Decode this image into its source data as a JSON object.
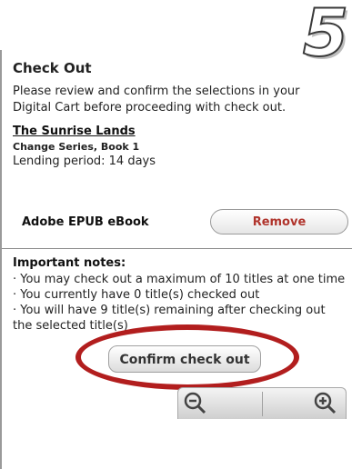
{
  "step_number": "5",
  "checkout": {
    "title": "Check Out",
    "intro": "Please review and confirm the selections in your Digital Cart before proceeding with check out."
  },
  "item": {
    "title": "The Sunrise Lands",
    "series": "Change Series, Book 1",
    "lending_period": "Lending period: 14 days",
    "format": "Adobe EPUB eBook",
    "remove_label": "Remove"
  },
  "notes": {
    "heading": "Important notes:",
    "lines": [
      "· You may check out a maximum of 10 titles at one time",
      "· You currently have 0 title(s) checked out",
      "· You will have 9 title(s) remaining after checking out the selected title(s)"
    ]
  },
  "confirm_label": "Confirm check out",
  "zoom": {
    "out_icon": "zoom-out-icon",
    "in_icon": "zoom-in-icon"
  },
  "colors": {
    "remove_text": "#b0342c",
    "highlight_ellipse": "#b21e1e"
  }
}
